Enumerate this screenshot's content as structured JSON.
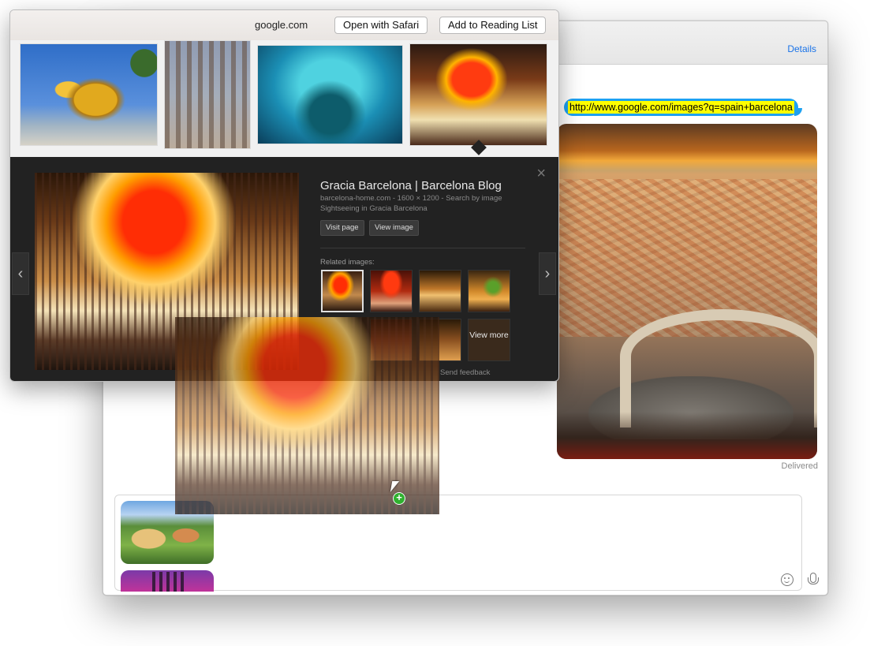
{
  "messages": {
    "details_label": "Details",
    "sent_link": "http://www.google.com/images?q=spain+barcelona",
    "status": "Delivered"
  },
  "popover": {
    "domain": "google.com",
    "open_button": "Open with Safari",
    "reading_list_button": "Add to Reading List",
    "detail": {
      "title": "Gracia Barcelona | Barcelona Blog",
      "meta": "barcelona-home.com - 1600 × 1200 - Search by image",
      "description": "Sightseeing in Gracia Barcelona",
      "visit_button": "Visit page",
      "view_button": "View image",
      "related_label": "Related images:",
      "view_more": "View more",
      "feedback": "Send feedback",
      "close_glyph": "×",
      "prev_glyph": "‹",
      "next_glyph": "›"
    }
  },
  "drag": {
    "badge": "+"
  },
  "icons": {
    "emoji": "emoji-icon",
    "mic": "microphone-icon",
    "cursor": "cursor-icon"
  }
}
